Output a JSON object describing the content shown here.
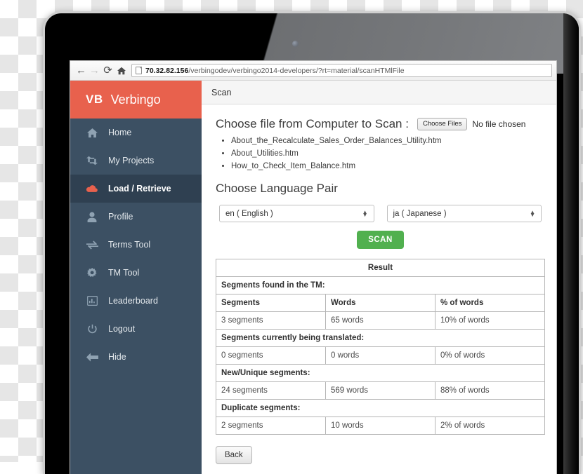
{
  "browser": {
    "back_icon": "arrow-left-icon",
    "forward_icon": "arrow-right-icon",
    "reload_icon": "reload-icon",
    "home_icon": "home-icon",
    "url_host": "70.32.82.156",
    "url_path": "/verbingodev/verbingo2014-developers/?rt=material/scanHTMlFile"
  },
  "sidebar": {
    "brand_mark": "VB",
    "brand_name": "Verbingo",
    "brand_color": "#e8614d",
    "background_color": "#3c5063",
    "active_background_color": "#2f4051",
    "items": [
      {
        "label": "Home",
        "icon": "home-icon",
        "active": false
      },
      {
        "label": "My Projects",
        "icon": "retweet-icon",
        "active": false
      },
      {
        "label": "Load / Retrieve",
        "icon": "cloud-icon",
        "active": true
      },
      {
        "label": "Profile",
        "icon": "user-icon",
        "active": false
      },
      {
        "label": "Terms Tool",
        "icon": "exchange-arrows-icon",
        "active": false
      },
      {
        "label": "TM Tool",
        "icon": "gear-icon",
        "active": false
      },
      {
        "label": "Leaderboard",
        "icon": "bar-chart-icon",
        "active": false
      },
      {
        "label": "Logout",
        "icon": "power-icon",
        "active": false
      },
      {
        "label": "Hide",
        "icon": "arrow-left-icon",
        "active": false
      }
    ]
  },
  "content": {
    "panel_title": "Scan",
    "file_heading": "Choose file from Computer to Scan :",
    "choose_files_label": "Choose Files",
    "no_file_text": "No file chosen",
    "files": [
      "About_the_Recalculate_Sales_Order_Balances_Utility.htm",
      "About_Utilities.htm",
      "How_to_Check_Item_Balance.htm"
    ],
    "language_heading": "Choose Language Pair",
    "source_language": "en ( English )",
    "target_language": "ja ( Japanese )",
    "scan_button": "SCAN",
    "back_button": "Back",
    "scan_button_color": "#51b04f"
  },
  "result_table": {
    "title": "Result",
    "columns": [
      "Segments",
      "Words",
      "% of words"
    ],
    "sections": [
      {
        "heading": "Segments found in the TM:",
        "has_column_header": true,
        "segments": "3 segments",
        "words": "65 words",
        "percent": "10% of words"
      },
      {
        "heading": "Segments currently being translated:",
        "has_column_header": false,
        "segments": "0 segments",
        "words": "0 words",
        "percent": "0% of words"
      },
      {
        "heading": "New/Unique segments:",
        "has_column_header": false,
        "segments": "24 segments",
        "words": "569 words",
        "percent": "88% of words"
      },
      {
        "heading": "Duplicate segments:",
        "has_column_header": false,
        "segments": "2 segments",
        "words": "10 words",
        "percent": "2% of words"
      }
    ]
  }
}
